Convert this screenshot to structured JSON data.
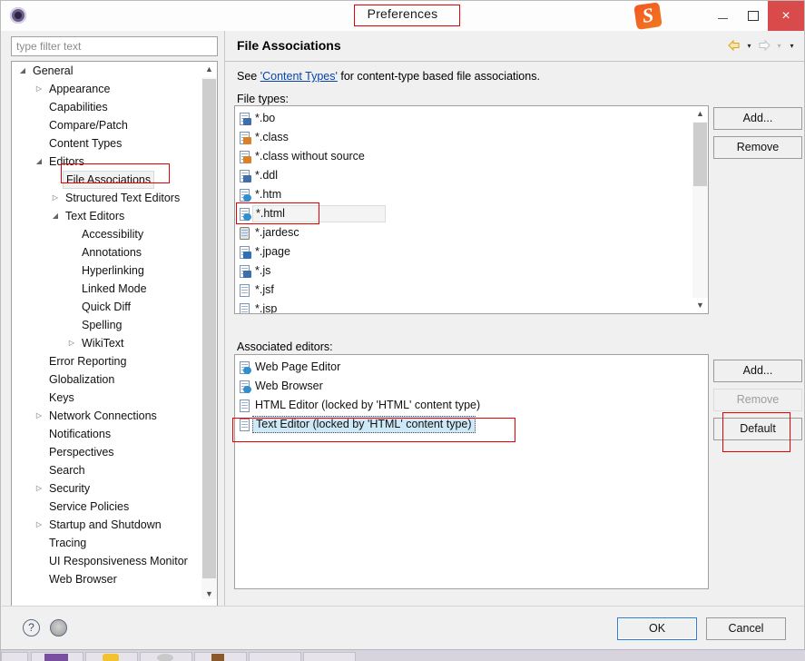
{
  "window": {
    "title": "Preferences",
    "app_icon": "eclipse-icon",
    "brand_logo": "sogou-logo",
    "controls": {
      "minimize": "minimize-icon",
      "maximize": "maximize-icon",
      "close": "×"
    },
    "close_color": "#d94a4a"
  },
  "sidebar": {
    "filter": {
      "value": "",
      "placeholder": "type filter text"
    },
    "items": [
      {
        "label": "General",
        "indent": 0,
        "twisty": "expanded",
        "selected": false
      },
      {
        "label": "Appearance",
        "indent": 1,
        "twisty": "collapsed",
        "selected": false
      },
      {
        "label": "Capabilities",
        "indent": 1,
        "twisty": "none",
        "selected": false
      },
      {
        "label": "Compare/Patch",
        "indent": 1,
        "twisty": "none",
        "selected": false
      },
      {
        "label": "Content Types",
        "indent": 1,
        "twisty": "none",
        "selected": false
      },
      {
        "label": "Editors",
        "indent": 1,
        "twisty": "expanded",
        "selected": false
      },
      {
        "label": "File Associations",
        "indent": 2,
        "twisty": "none",
        "selected": true
      },
      {
        "label": "Structured Text Editors",
        "indent": 2,
        "twisty": "collapsed",
        "selected": false
      },
      {
        "label": "Text Editors",
        "indent": 2,
        "twisty": "expanded",
        "selected": false
      },
      {
        "label": "Accessibility",
        "indent": 3,
        "twisty": "none",
        "selected": false
      },
      {
        "label": "Annotations",
        "indent": 3,
        "twisty": "none",
        "selected": false
      },
      {
        "label": "Hyperlinking",
        "indent": 3,
        "twisty": "none",
        "selected": false
      },
      {
        "label": "Linked Mode",
        "indent": 3,
        "twisty": "none",
        "selected": false
      },
      {
        "label": "Quick Diff",
        "indent": 3,
        "twisty": "none",
        "selected": false
      },
      {
        "label": "Spelling",
        "indent": 3,
        "twisty": "none",
        "selected": false
      },
      {
        "label": "WikiText",
        "indent": 3,
        "twisty": "collapsed",
        "selected": false
      },
      {
        "label": "Error Reporting",
        "indent": 1,
        "twisty": "none",
        "selected": false
      },
      {
        "label": "Globalization",
        "indent": 1,
        "twisty": "none",
        "selected": false
      },
      {
        "label": "Keys",
        "indent": 1,
        "twisty": "none",
        "selected": false
      },
      {
        "label": "Network Connections",
        "indent": 1,
        "twisty": "collapsed",
        "selected": false
      },
      {
        "label": "Notifications",
        "indent": 1,
        "twisty": "none",
        "selected": false
      },
      {
        "label": "Perspectives",
        "indent": 1,
        "twisty": "none",
        "selected": false
      },
      {
        "label": "Search",
        "indent": 1,
        "twisty": "none",
        "selected": false
      },
      {
        "label": "Security",
        "indent": 1,
        "twisty": "collapsed",
        "selected": false
      },
      {
        "label": "Service Policies",
        "indent": 1,
        "twisty": "none",
        "selected": false
      },
      {
        "label": "Startup and Shutdown",
        "indent": 1,
        "twisty": "collapsed",
        "selected": false
      },
      {
        "label": "Tracing",
        "indent": 1,
        "twisty": "none",
        "selected": false
      },
      {
        "label": "UI Responsiveness Monitor",
        "indent": 1,
        "twisty": "none",
        "selected": false
      },
      {
        "label": "Web Browser",
        "indent": 1,
        "twisty": "none",
        "selected": false
      }
    ]
  },
  "page": {
    "title": "File Associations",
    "nav": {
      "back_icon": "back-arrow-icon",
      "back_caret": "▾",
      "forward_icon": "forward-arrow-icon",
      "forward_caret": "▾",
      "menu_caret": "▾"
    },
    "description_prefix": "See ",
    "description_link": "'Content Types'",
    "description_suffix": " for content-type based file associations.",
    "file_types_label": "File types:",
    "associated_editors_label": "Associated editors:",
    "file_types": [
      {
        "label": "*.bo",
        "icon": "file-bo-icon",
        "badge": "b-blue",
        "selected": false
      },
      {
        "label": "*.class",
        "icon": "file-class-icon",
        "badge": "b-orange",
        "selected": false
      },
      {
        "label": "*.class without source",
        "icon": "file-class-icon",
        "badge": "b-orange",
        "selected": false
      },
      {
        "label": "*.ddl",
        "icon": "file-ddl-icon",
        "badge": "b-blue",
        "selected": false
      },
      {
        "label": "*.htm",
        "icon": "file-htm-icon",
        "badge": "b-globe",
        "selected": false
      },
      {
        "label": "*.html",
        "icon": "file-html-icon",
        "badge": "b-globe",
        "selected": true
      },
      {
        "label": "*.jardesc",
        "icon": "file-jardesc-icon",
        "badge": "b-none",
        "selected": false
      },
      {
        "label": "*.jpage",
        "icon": "file-jpage-icon",
        "badge": "b-j",
        "selected": false
      },
      {
        "label": "*.js",
        "icon": "file-js-icon",
        "badge": "b-blue",
        "selected": false
      },
      {
        "label": "*.jsf",
        "icon": "file-jsf-icon",
        "badge": "b-none",
        "selected": false
      },
      {
        "label": "*.jsp",
        "icon": "file-jsp-icon",
        "badge": "b-none",
        "selected": false
      }
    ],
    "associated_editors": [
      {
        "label": "Web Page Editor",
        "icon": "web-page-editor-icon",
        "badge": "b-globe",
        "selected": false
      },
      {
        "label": "Web Browser",
        "icon": "web-browser-icon",
        "badge": "b-globe",
        "selected": false
      },
      {
        "label": "HTML Editor (locked by 'HTML' content type)",
        "icon": "html-editor-icon",
        "badge": "b-none",
        "selected": false
      },
      {
        "label": "Text Editor (locked by 'HTML' content type)",
        "icon": "text-editor-icon",
        "badge": "b-none",
        "selected": true
      }
    ],
    "file_type_buttons": {
      "add": "Add...",
      "remove": "Remove"
    },
    "editor_buttons": {
      "add": "Add...",
      "remove": "Remove",
      "default": "Default"
    }
  },
  "footer": {
    "help_icon": "?",
    "restore_icon": "restore-defaults-icon",
    "ok": "OK",
    "cancel": "Cancel"
  },
  "annotations": {
    "accent_color": "#e60000",
    "boxes": [
      "title-preferences",
      "tree-file-associations",
      "filetype-html",
      "associated-editor-text-editor",
      "default-button"
    ]
  }
}
